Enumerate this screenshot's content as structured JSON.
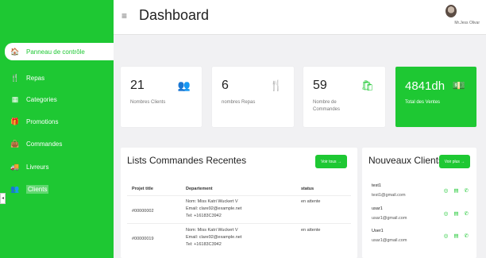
{
  "sidebar": {
    "items": [
      {
        "icon": "dashboard-icon",
        "glyph": "🏠",
        "label": "Panneau de contrôle"
      },
      {
        "icon": "cutlery-icon",
        "glyph": "🍴",
        "label": "Repas"
      },
      {
        "icon": "categories-icon",
        "glyph": "▦",
        "label": "Categories"
      },
      {
        "icon": "gift-icon",
        "glyph": "🎁",
        "label": "Promotions"
      },
      {
        "icon": "bag-icon",
        "glyph": "👜",
        "label": "Commandes"
      },
      {
        "icon": "truck-icon",
        "glyph": "🚚",
        "label": "Livreurs"
      },
      {
        "icon": "users-icon",
        "glyph": "👥",
        "label": "Clients"
      }
    ]
  },
  "header": {
    "menu_glyph": "≡",
    "title": "Dashboard",
    "user_name": "Mr.Jess Olivar"
  },
  "cards": [
    {
      "value": "21",
      "label": "Nombres Clients",
      "glyph": "👥",
      "icon": "users-icon"
    },
    {
      "value": "6",
      "label": "nombres Repas",
      "glyph": "🍴",
      "icon": "cutlery-icon"
    },
    {
      "value": "59",
      "label": "Nombre de Commandes",
      "glyph": "🛍",
      "icon": "shopping-bag-icon"
    },
    {
      "value": "4841dh",
      "label": "Total des Ventes",
      "glyph": "💵",
      "icon": "money-icon"
    }
  ],
  "orders": {
    "title": "Lists Commandes Recentes",
    "button": "Voir tous →",
    "columns": [
      "Projet title",
      "Departement",
      "status"
    ],
    "rows": [
      {
        "id": "#00000002",
        "name": "Nom: Miss Katri Wuckert V",
        "email": "Email: clare92@example.net",
        "tel": "Tel: +16183C3942",
        "status": "en attente"
      },
      {
        "id": "#00000019",
        "name": "Nom: Miss Katri Wuckert V",
        "email": "Email: clare92@example.net",
        "tel": "Tel: +16183C3942",
        "status": "en attente"
      }
    ]
  },
  "clients": {
    "title": "Nouveaux Clients",
    "button": "Voir plus →",
    "items": [
      {
        "name": "test1",
        "email": "test1@gmail.com"
      },
      {
        "name": "usar1",
        "email": "usar1@gmail.com"
      },
      {
        "name": "User1",
        "email": "usar1@gmail.com"
      }
    ],
    "action_glyphs": [
      "◎",
      "▤",
      "✆"
    ]
  },
  "colors": {
    "accent": "#1ec833",
    "background": "#f1f1f3"
  }
}
